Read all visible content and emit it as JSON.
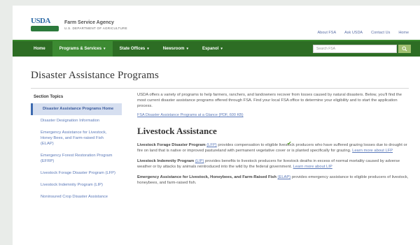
{
  "header": {
    "logo_text": "USDA",
    "agency_name": "Farm Service Agency",
    "agency_sub": "U.S. DEPARTMENT OF AGRICULTURE"
  },
  "utility_links": [
    "About FSA",
    "Ask USDA",
    "Contact Us",
    "Home"
  ],
  "nav": {
    "items": [
      {
        "label": "Home",
        "active": false,
        "caret": false
      },
      {
        "label": "Programs & Services",
        "active": true,
        "caret": true
      },
      {
        "label": "State Offices",
        "active": false,
        "caret": true
      },
      {
        "label": "Newsroom",
        "active": false,
        "caret": true
      },
      {
        "label": "Espanol",
        "active": false,
        "caret": true
      }
    ],
    "search_placeholder": "Search FSA"
  },
  "page_title": "Disaster Assistance Programs",
  "sidebar": {
    "heading": "Section Topics",
    "items": [
      {
        "label": "Disaster Assistance Programs Home",
        "active": true
      },
      {
        "label": "Disaster Designation Information",
        "active": false
      },
      {
        "label": "Emergency Assistance for Livestock, Honey Bees, and Farm-raised Fish (ELAP)",
        "active": false
      },
      {
        "label": "Emergency Forest Restoration Program (EFRP)",
        "active": false
      },
      {
        "label": "Livestock Forage Disaster Program (LFP)",
        "active": false
      },
      {
        "label": "Livestock Indemnity Program (LIP)",
        "active": false
      },
      {
        "label": "Noninsured Crop Disaster Assistance",
        "active": false
      }
    ]
  },
  "content": {
    "intro": "USDA offers a variety of programs to help farmers, ranchers, and landowners recover from losses caused by natural disasters. Below, you'll find the most current disaster assistance programs offered through FSA. Find your local FSA office to determine your eligibility and to start the application process.",
    "link_line": "FSA Disaster Assistance Programs at a Glance (PDF, 600 KB)",
    "section_heading": "Livestock Assistance",
    "programs": [
      {
        "name": "Livestock Forage Disaster Program",
        "abbr": "(LFP)",
        "text": "provides compensation to eligible livestock producers who have suffered grazing losses due to drought or fire on land that is native or improved pastureland with permanent vegetative cover or is planted specifically for grazing.",
        "link": "Learn more about LFP"
      },
      {
        "name": "Livestock Indemnity Program",
        "abbr": "(LIP)",
        "text": "provides benefits to livestock producers for livestock deaths in excess of normal mortality caused by adverse weather or by attacks by animals reintroduced into the wild by the federal government.",
        "link": "Learn more about LIP"
      },
      {
        "name": "Emergency Assistance for Livestock, Honeybees, and Farm-Raised Fish",
        "abbr": "(ELAP)",
        "text": "provides emergency assistance to eligible producers of livestock, honeybees, and farm-raised fish.",
        "link": ""
      }
    ]
  }
}
